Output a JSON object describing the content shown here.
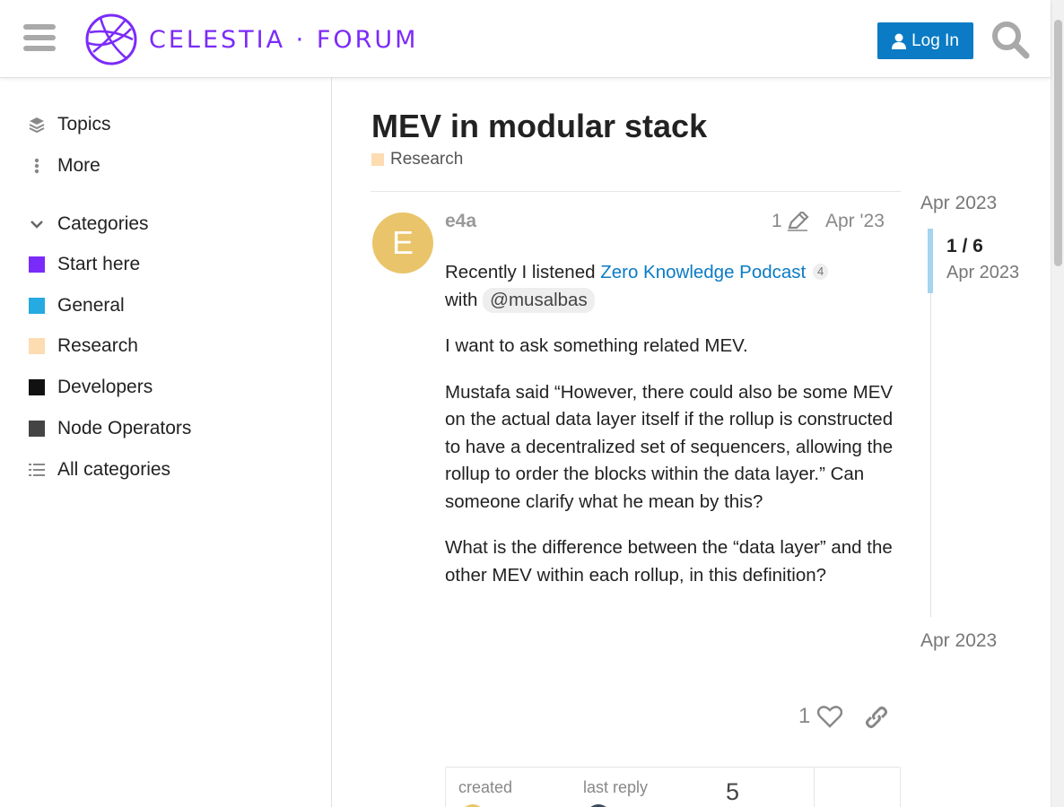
{
  "header": {
    "logo_text": "CELESTIA · FORUM",
    "login_label": "Log In",
    "accent": "#7b2bf9",
    "login_bg": "#0a7bc4"
  },
  "sidebar": {
    "nav": [
      {
        "label": "Topics",
        "icon": "layers-icon"
      },
      {
        "label": "More",
        "icon": "vertical-ellipsis-icon"
      }
    ],
    "categories_label": "Categories",
    "categories": [
      {
        "label": "Start here",
        "color": "#7b2bf9"
      },
      {
        "label": "General",
        "color": "#25aae1"
      },
      {
        "label": "Research",
        "color": "#fddcb1"
      },
      {
        "label": "Developers",
        "color": "#111111"
      },
      {
        "label": "Node Operators",
        "color": "#444444"
      }
    ],
    "all_categories_label": "All categories"
  },
  "topic": {
    "title": "MEV in modular stack",
    "category": "Research",
    "category_color": "#fddcb1"
  },
  "post": {
    "avatar_letter": "E",
    "avatar_color": "#e9c46a",
    "username": "e4a",
    "edit_count": "1",
    "date": "Apr '23",
    "p1_text": "Recently I listened ",
    "p1_link": "Zero Knowledge Podcast",
    "p1_link_clicks": "4",
    "p1_with": "with ",
    "p1_mention": "@musalbas",
    "p2": "I want to ask something related MEV.",
    "p3": "Mustafa said “However, there could also be some MEV on the actual data layer itself if the rollup is constructed to have a decentralized set of sequencers, allowing the rollup to order the blocks within the data layer.” Can someone clarify what he mean by this?",
    "p4": "What is the difference between the “data layer” and the other MEV within each rollup, in this definition?",
    "likes": "1"
  },
  "topic_map": {
    "created_label": "created",
    "last_reply_label": "last reply",
    "replies_count": "5"
  },
  "timeline": {
    "top_date": "Apr 2023",
    "position": "1 / 6",
    "position_date": "Apr 2023",
    "bottom_date": "Apr 2023"
  }
}
